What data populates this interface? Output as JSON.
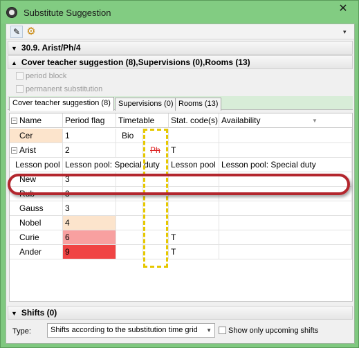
{
  "window": {
    "title": "Substitute Suggestion",
    "close_glyph": "✕",
    "title_icon": "clock-icon"
  },
  "toolbar": {
    "edit_icon": "edit-pencil-icon",
    "settings_icon": "gear-icon",
    "overflow_glyph": "▾"
  },
  "sections": {
    "lesson_header": "30.9.  Arist/Ph/4",
    "cover_header": "Cover teacher suggestion (8),Supervisions (0),Rooms (13)",
    "shifts_header": "Shifts (0)"
  },
  "options": {
    "period_block": "period block",
    "permanent_substitution": "permanent substitution"
  },
  "tabs": [
    {
      "label": "Cover teacher suggestion (8)",
      "active": true
    },
    {
      "label": "Supervisions (0)",
      "active": false
    },
    {
      "label": "Rooms (13)",
      "active": false
    }
  ],
  "grid": {
    "columns": [
      "Name",
      "Period flag",
      "Timetable",
      "Stat. code(s)",
      "Availability"
    ],
    "rows": [
      {
        "name": "Cer",
        "flag": "1",
        "timetable": "Bio",
        "slot": "",
        "stat": "",
        "availability": ""
      },
      {
        "name": "Arist",
        "flag": "2",
        "timetable": "",
        "slot": "Ph",
        "stat": "T",
        "availability": ""
      },
      {
        "name": "Lesson pool",
        "flag": "Lesson pool: Special duty",
        "timetable": "",
        "slot": "",
        "stat": "Lesson pool",
        "availability": "Lesson pool: Special duty"
      },
      {
        "name": "New",
        "flag": "3",
        "timetable": "",
        "slot": "",
        "stat": "",
        "availability": ""
      },
      {
        "name": "Rub",
        "flag": "3",
        "timetable": "",
        "slot": "",
        "stat": "",
        "availability": ""
      },
      {
        "name": "Gauss",
        "flag": "3",
        "timetable": "",
        "slot": "",
        "stat": "",
        "availability": ""
      },
      {
        "name": "Nobel",
        "flag": "4",
        "timetable": "",
        "slot": "",
        "stat": "",
        "availability": ""
      },
      {
        "name": "Curie",
        "flag": "6",
        "timetable": "",
        "slot": "",
        "stat": "T",
        "availability": ""
      },
      {
        "name": "Ander",
        "flag": "9",
        "timetable": "",
        "slot": "",
        "stat": "T",
        "availability": ""
      }
    ],
    "colors": {
      "name_bg": "#fce4cc",
      "flag_4": "#fce4cc",
      "flag_6": "#f8a0a0",
      "flag_9": "#f04444",
      "slot_border": "#e6c800",
      "highlight": "#b3262d"
    }
  },
  "footer": {
    "type_label": "Type:",
    "type_value": "Shifts according to the substitution time grid",
    "upcoming_label": "Show only upcoming shifts"
  }
}
